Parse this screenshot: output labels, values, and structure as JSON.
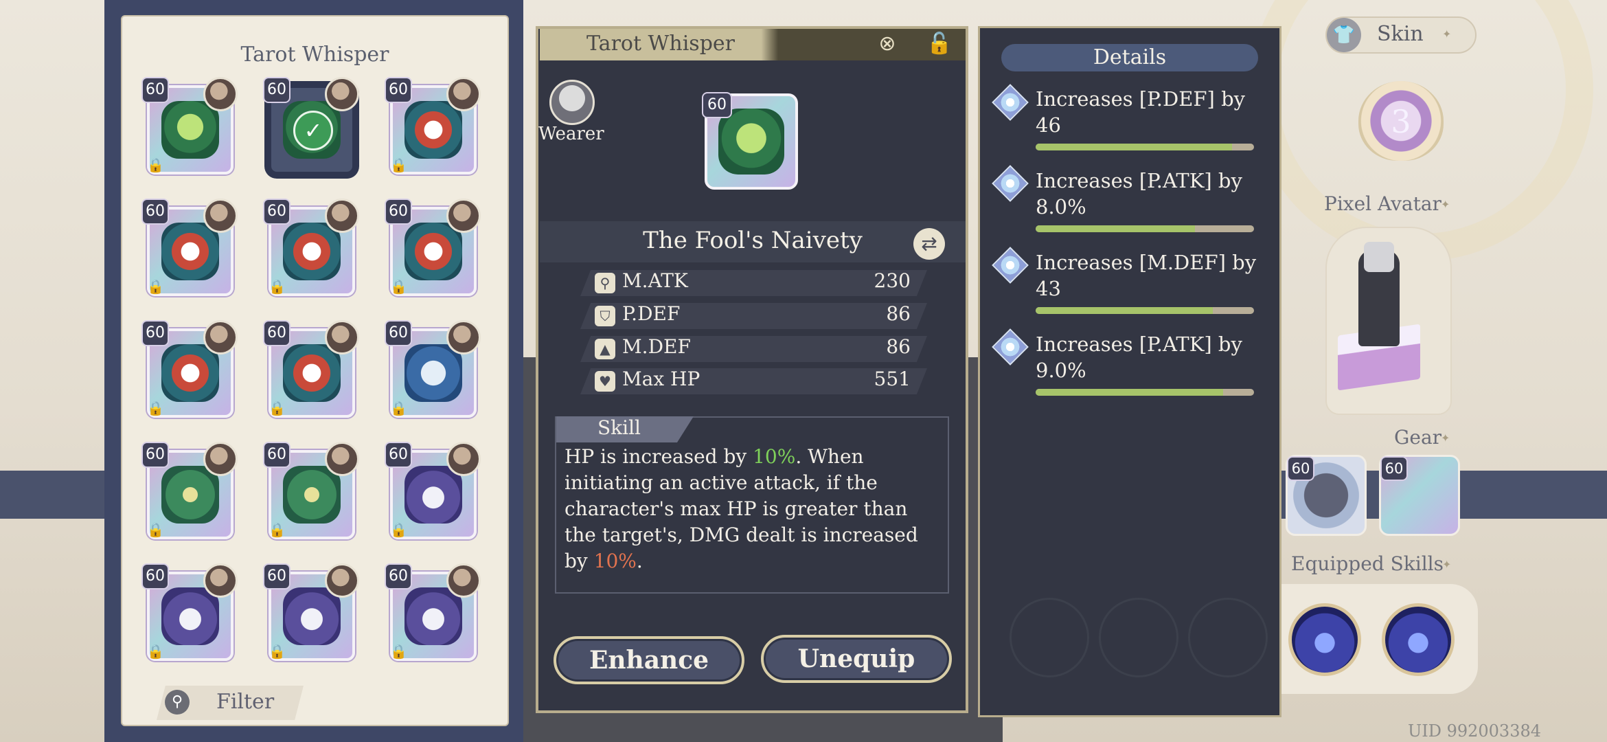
{
  "left_panel": {
    "title": "Tarot Whisper",
    "filter_label": "Filter",
    "cards": [
      {
        "level": "60",
        "emblem": "green",
        "locked": true,
        "selected": false
      },
      {
        "level": "60",
        "emblem": "green",
        "locked": false,
        "selected": true
      },
      {
        "level": "60",
        "emblem": "red",
        "locked": true,
        "selected": false
      },
      {
        "level": "60",
        "emblem": "red",
        "locked": true,
        "selected": false
      },
      {
        "level": "60",
        "emblem": "red",
        "locked": true,
        "selected": false
      },
      {
        "level": "60",
        "emblem": "red",
        "locked": true,
        "selected": false
      },
      {
        "level": "60",
        "emblem": "red",
        "locked": true,
        "selected": false
      },
      {
        "level": "60",
        "emblem": "red",
        "locked": true,
        "selected": false
      },
      {
        "level": "60",
        "emblem": "blue",
        "locked": true,
        "selected": false
      },
      {
        "level": "60",
        "emblem": "cross",
        "locked": true,
        "selected": false
      },
      {
        "level": "60",
        "emblem": "cross",
        "locked": true,
        "selected": false
      },
      {
        "level": "60",
        "emblem": "purple",
        "locked": true,
        "selected": false
      },
      {
        "level": "60",
        "emblem": "purple",
        "locked": true,
        "selected": false
      },
      {
        "level": "60",
        "emblem": "purple",
        "locked": true,
        "selected": false
      },
      {
        "level": "60",
        "emblem": "purple",
        "locked": true,
        "selected": false
      }
    ]
  },
  "center": {
    "header_title": "Tarot Whisper",
    "header_icons": [
      "close-icon",
      "lock-icon"
    ],
    "wearer_label": "Wearer",
    "card_level": "60",
    "tarot_name": "The Fool's Naivety",
    "stats": [
      {
        "label": "M.ATK",
        "value": "230",
        "icon": "wand-icon"
      },
      {
        "label": "P.DEF",
        "value": "86",
        "icon": "shield-icon"
      },
      {
        "label": "M.DEF",
        "value": "86",
        "icon": "hat-icon"
      },
      {
        "label": "Max HP",
        "value": "551",
        "icon": "heart-icon"
      }
    ],
    "skill_tab": "Skill",
    "skill_text": {
      "p1": "HP is increased by ",
      "v1": "10%",
      "p2": ". When initiating an active attack, if the character's max HP is greater than the target's, DMG dealt is increased by ",
      "v2": "10%",
      "p3": "."
    },
    "enhance_label": "Enhance",
    "unequip_label": "Unequip"
  },
  "details": {
    "title": "Details",
    "items": [
      {
        "text": "Increases [P.DEF] by 46",
        "progress": 0.9
      },
      {
        "text": "Increases [P.ATK] by 8.0%",
        "progress": 0.73
      },
      {
        "text": "Increases [M.DEF] by 43",
        "progress": 0.81
      },
      {
        "text": "Increases [P.ATK] by 9.0%",
        "progress": 0.86
      }
    ]
  },
  "right": {
    "skin_label": "Skin",
    "heart_count": "3",
    "pixel_avatar_label": "Pixel Avatar",
    "gear_label": "Gear",
    "gear_levels": [
      "60",
      "60"
    ],
    "equipped_skills_label": "Equipped Skills",
    "uid": "UID 992003384"
  },
  "colors": {
    "panel_dark": "#333643",
    "panel_light": "#f1ece0",
    "accent_gold": "#b8ad8d",
    "highlight_green": "#7fd15a",
    "highlight_red": "#e2734f",
    "progress_fill": "#a7c46a"
  }
}
